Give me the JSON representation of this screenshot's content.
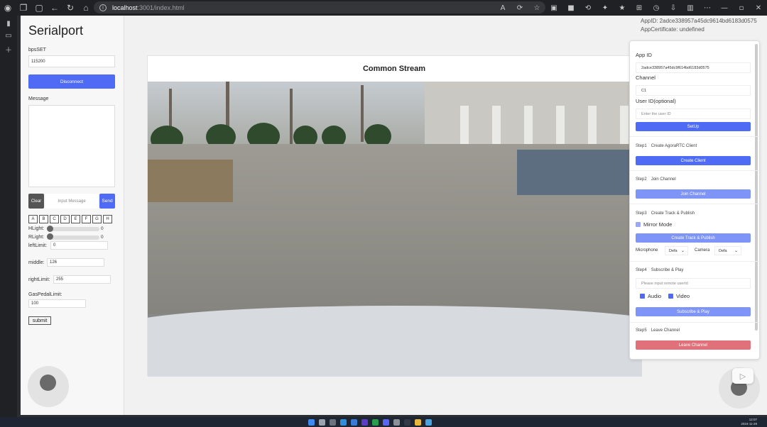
{
  "browser": {
    "url_host": "localhost",
    "url_path": ":3001/index.html",
    "icons": [
      "tab-icon",
      "back-icon",
      "refresh-icon",
      "home-icon",
      "info-icon"
    ]
  },
  "serial": {
    "title": "Serialport",
    "bps_label": "bpsSET",
    "bps_value": "115200",
    "disconnect_label": "Disconnect",
    "message_label": "Message",
    "clear_label": "Clear",
    "input_placeholder": "Input Message",
    "send_label": "Send",
    "keys": [
      "A",
      "B",
      "C",
      "D",
      "E",
      "F",
      "G",
      "H"
    ],
    "hlight_label": "HLight:",
    "hlight_value": "0",
    "rlight_label": "RLight:",
    "rlight_value": "0",
    "leftlimit_label": "leftLimit:",
    "leftlimit_value": "0",
    "middle_label": "middle:",
    "middle_value": "126",
    "rightlimit_label": "rightLimit:",
    "rightlimit_value": "255",
    "gaspedal_label": "GasPedalLimit:",
    "gaspedal_value": "100",
    "submit_label": "submit"
  },
  "stream": {
    "title": "Common Stream"
  },
  "overlay": {
    "appid_text": "AppID: 2adce338957a45dc9614bd6183d0575",
    "cert_text": "AppCertificate: undefined"
  },
  "agora": {
    "appid_label": "App ID",
    "appid_value": "2adce338957a45dc9f614bd6183d0575",
    "channel_label": "Channel",
    "channel_value": "C1",
    "userid_label": "User ID(optional)",
    "userid_placeholder": "Enter the user ID",
    "setup_label": "SetUp",
    "step1_num": "Step1",
    "step1_text": "Create AgoraRTC Client",
    "create_client_label": "Create Client",
    "step2_num": "Step2",
    "step2_text": "Join Channel",
    "join_channel_label": "Join Channel",
    "step3_num": "Step3",
    "step3_text": "Create Track & Publish",
    "mirror_label": "Mirror Mode",
    "create_track_label": "Create Track & Publish",
    "microphone_label": "Microphone",
    "microphone_value": "Defa",
    "camera_label": "Camera",
    "camera_value": "Defa",
    "step4_num": "Step4",
    "step4_text": "Subscribe & Play",
    "remote_placeholder": "Please input remote userId",
    "audio_label": "Audio",
    "video_label": "Video",
    "subscribe_label": "Subscribe & Play",
    "step5_num": "Step5",
    "step5_text": "Leave Channel",
    "leave_label": "Leave Channel"
  },
  "colors": {
    "primary": "#4f6bf5",
    "primary_light": "#7e94f7",
    "danger": "#e0707a"
  },
  "taskbar": {
    "time": "12:07",
    "date": "2024-11-29"
  }
}
